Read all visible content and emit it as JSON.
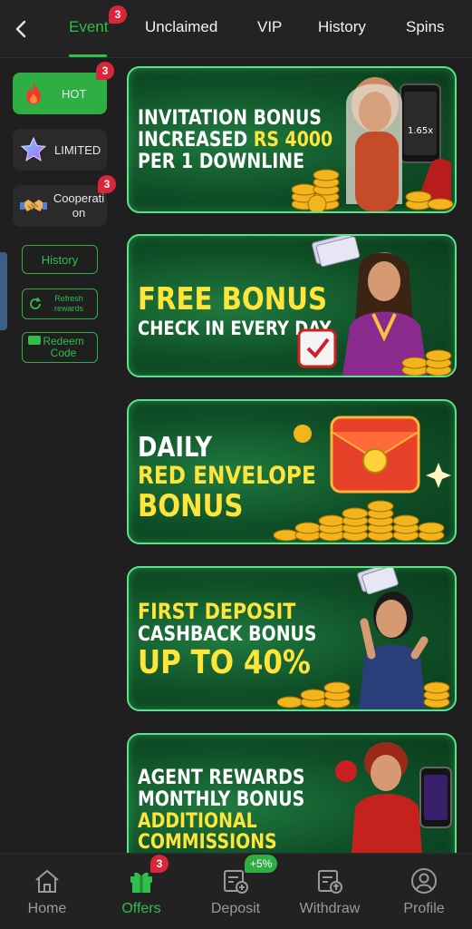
{
  "header": {
    "tabs": [
      {
        "label": "Event",
        "badge": "3",
        "active": true
      },
      {
        "label": "Unclaimed"
      },
      {
        "label": "VIP"
      },
      {
        "label": "History"
      },
      {
        "label": "Spins"
      }
    ]
  },
  "sidebar": {
    "categories": [
      {
        "label": "HOT",
        "badge": "3",
        "icon": "fire-icon",
        "active": true
      },
      {
        "label": "LIMITED",
        "icon": "star-icon"
      },
      {
        "label": "Cooperati on",
        "badge": "3",
        "icon": "handshake-icon"
      }
    ],
    "history_label": "History",
    "refresh_label": "Refresh rewards",
    "redeem_label": "Redeem Code"
  },
  "banners": [
    {
      "lines": [
        {
          "text": "INVITATION BONUS"
        },
        {
          "text": "INCREASED ",
          "highlight": "RS 4000"
        },
        {
          "text": "PER 1 DOWNLINE"
        }
      ],
      "screen_text": "1.65x"
    },
    {
      "lines": [
        {
          "highlight": "FREE BONUS"
        },
        {
          "text": "CHECK IN EVERY DAY"
        }
      ]
    },
    {
      "lines": [
        {
          "text": "DAILY"
        },
        {
          "highlight": "RED ENVELOPE"
        },
        {
          "highlight": "BONUS"
        }
      ]
    },
    {
      "lines": [
        {
          "highlight": "FIRST DEPOSIT"
        },
        {
          "text": "CASHBACK BONUS"
        },
        {
          "highlight": "UP TO 40%"
        }
      ]
    },
    {
      "lines": [
        {
          "text": "AGENT REWARDS"
        },
        {
          "text": "MONTHLY BONUS"
        },
        {
          "highlight": "ADDITIONAL"
        },
        {
          "highlight": "COMMISSIONS"
        }
      ]
    }
  ],
  "bottom_nav": {
    "items": [
      {
        "label": "Home",
        "icon": "home-icon"
      },
      {
        "label": "Offers",
        "icon": "gift-icon",
        "badge": "3",
        "active": true
      },
      {
        "label": "Deposit",
        "icon": "deposit-icon",
        "badge": "+5%"
      },
      {
        "label": "Withdraw",
        "icon": "withdraw-icon"
      },
      {
        "label": "Profile",
        "icon": "profile-icon"
      }
    ]
  },
  "colors": {
    "accent": "#2fbf4a",
    "badge": "#d8263a",
    "banner_highlight": "#ffe43a"
  }
}
